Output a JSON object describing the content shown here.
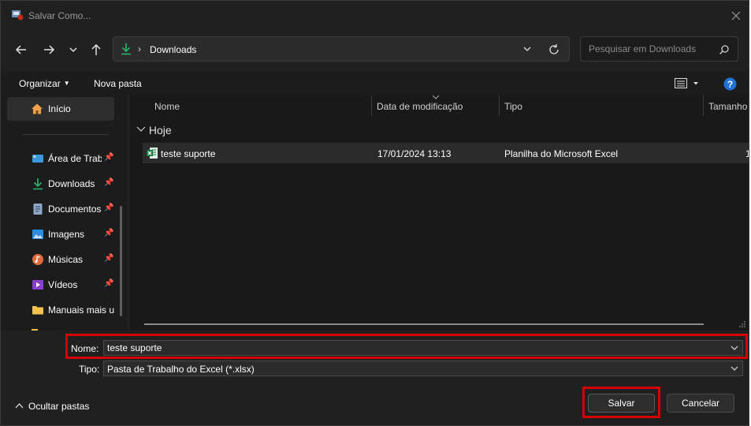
{
  "window": {
    "title": "Salvar Como..."
  },
  "address": {
    "current": "Downloads"
  },
  "search": {
    "placeholder": "Pesquisar em Downloads"
  },
  "commands": {
    "organize": "Organizar",
    "new_folder": "Nova pasta"
  },
  "sidebar": {
    "home": "Início",
    "items": [
      {
        "label": "Área de Trabalho",
        "icon": "desktop-icon",
        "pinned": true
      },
      {
        "label": "Downloads",
        "icon": "download-icon",
        "pinned": true
      },
      {
        "label": "Documentos",
        "icon": "documents-icon",
        "pinned": true
      },
      {
        "label": "Imagens",
        "icon": "pictures-icon",
        "pinned": true
      },
      {
        "label": "Músicas",
        "icon": "music-icon",
        "pinned": true
      },
      {
        "label": "Vídeos",
        "icon": "videos-icon",
        "pinned": true
      },
      {
        "label": "Manuais mais u",
        "icon": "folder-icon",
        "pinned": false
      }
    ]
  },
  "columns": {
    "name": "Nome",
    "modified": "Data de modificação",
    "type": "Tipo",
    "size": "Tamanho"
  },
  "group": {
    "label": "Hoje"
  },
  "files": [
    {
      "name": "teste suporte",
      "modified": "17/01/2024 13:13",
      "type": "Planilha do Microsoft Excel",
      "size": "1"
    }
  ],
  "form": {
    "name_label": "Nome:",
    "name_value": "teste suporte",
    "type_label": "Tipo:",
    "type_value": "Pasta de Trabalho do Excel (*.xlsx)"
  },
  "buttons": {
    "save": "Salvar",
    "cancel": "Cancelar",
    "hide_folders": "Ocultar pastas"
  },
  "colors": {
    "background": "#202020",
    "accent": "#0078d4",
    "highlight": "#d40000",
    "excel": "#107c41"
  }
}
